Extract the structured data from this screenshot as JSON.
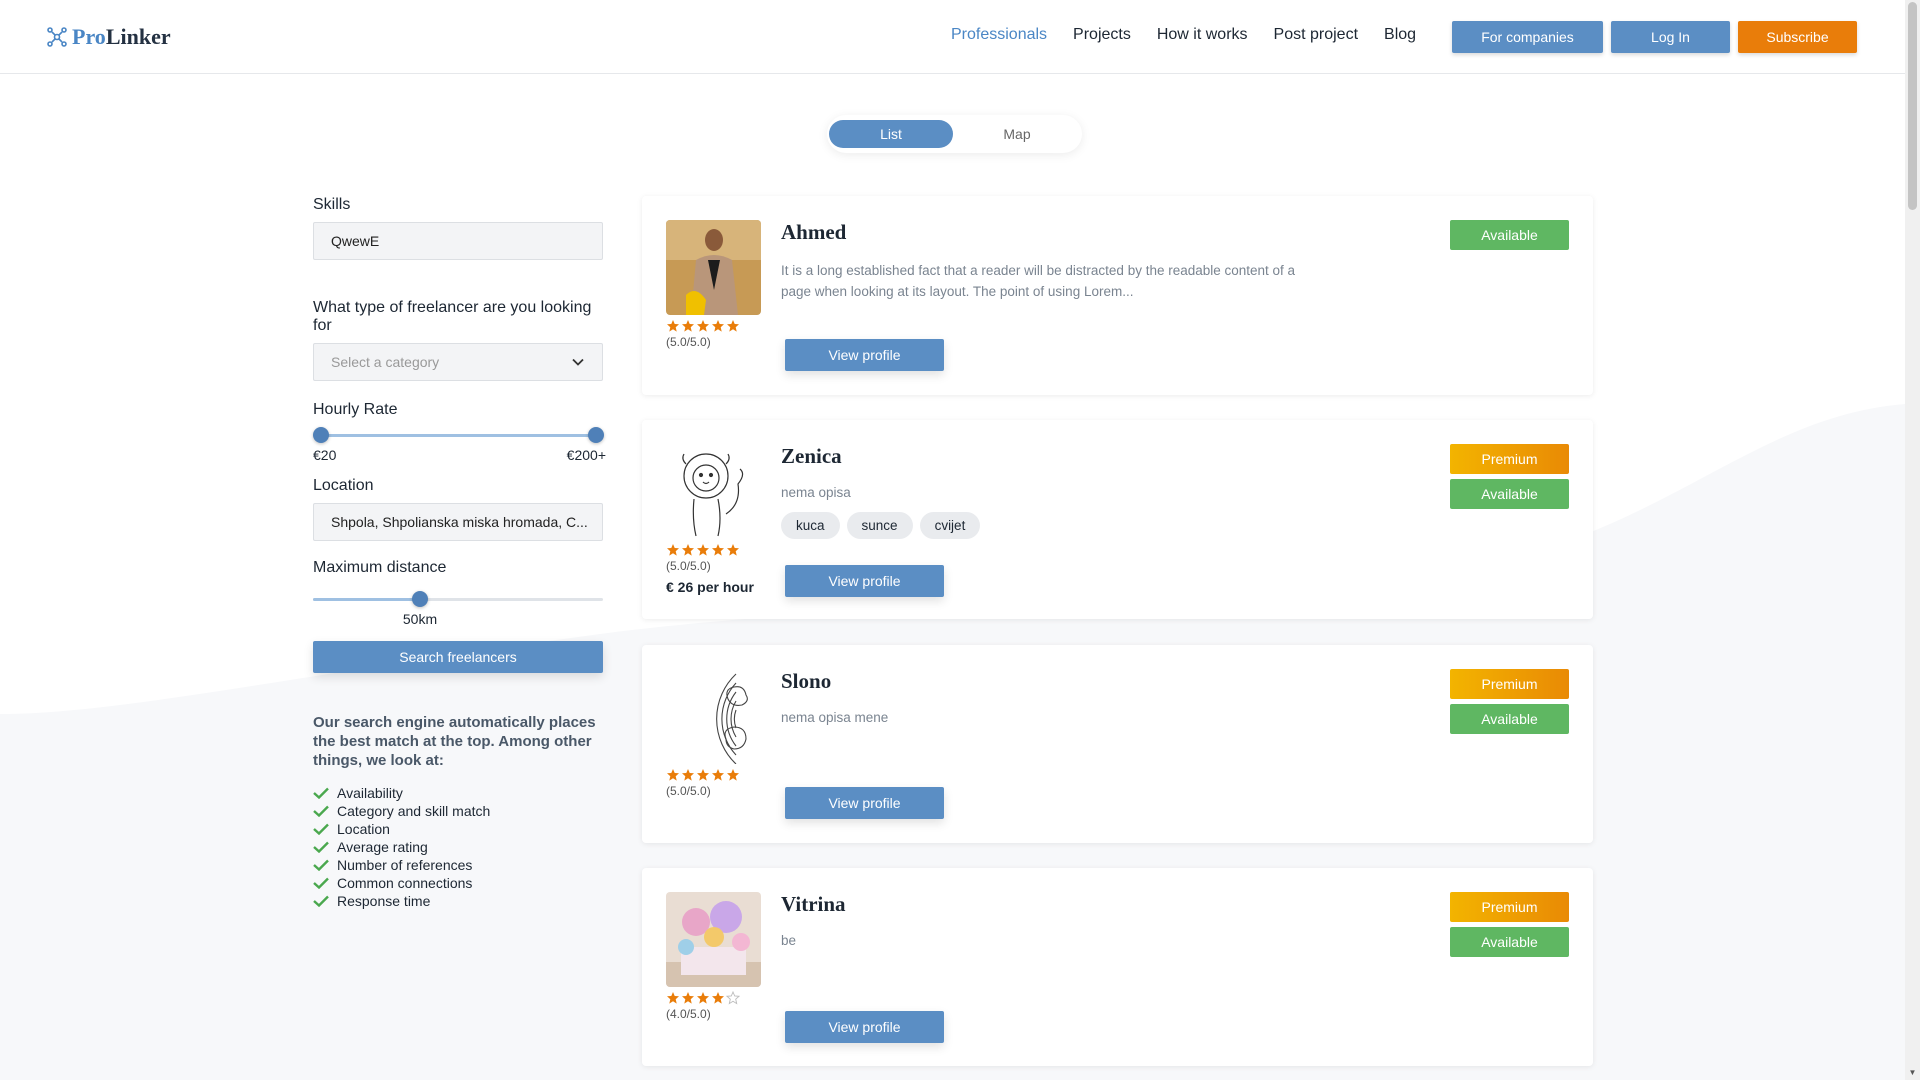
{
  "brand": {
    "pro": "Pro",
    "linker": "Linker"
  },
  "nav": [
    "Professionals",
    "Projects",
    "How it works",
    "Post project",
    "Blog"
  ],
  "header_buttons": {
    "companies": "For companies",
    "login": "Log In",
    "subscribe": "Subscribe"
  },
  "toggle": {
    "list": "List",
    "map": "Map"
  },
  "filters": {
    "skills_label": "Skills",
    "skills_value": "QwewE",
    "type_label": "What type of freelancer are you looking for",
    "type_placeholder": "Select a category",
    "rate_label": "Hourly Rate",
    "rate_min": "€20",
    "rate_max": "€200+",
    "location_label": "Location",
    "location_value": "Shpola, Shpolianska miska hromada, C...",
    "distance_label": "Maximum distance",
    "distance_value": "50km",
    "distance_fraction": 0.36,
    "search_button": "Search freelancers"
  },
  "info": {
    "text": "Our search engine automatically places the best match at the top. Among other things, we look at:",
    "items": [
      "Availability",
      "Category and skill match",
      "Location",
      "Average rating",
      "Number of references",
      "Common connections",
      "Response time"
    ]
  },
  "view_profile_label": "View profile",
  "freelancers": [
    {
      "name": "Ahmed",
      "description": "It is a long established fact that a reader will be distracted by the readable content of a page when looking at its layout. The point of using Lorem...",
      "rating": 5,
      "rating_text": "(5.0/5.0)",
      "badges": [
        "Available"
      ]
    },
    {
      "name": "Zenica",
      "description": "nema opisa",
      "tags": [
        "kuca",
        "sunce",
        "cvijet"
      ],
      "rating": 5,
      "rating_text": "(5.0/5.0)",
      "rate": "€ 26 per hour",
      "badges": [
        "Premium",
        "Available"
      ]
    },
    {
      "name": "Slono",
      "description": "nema opisa mene",
      "rating": 5,
      "rating_text": "(5.0/5.0)",
      "badges": [
        "Premium",
        "Available"
      ]
    },
    {
      "name": "Vitrina",
      "description": "be",
      "rating": 4,
      "rating_text": "(4.0/5.0)",
      "badges": [
        "Premium",
        "Available"
      ]
    }
  ],
  "colors": {
    "accent": "#5b8ec4",
    "orange": "#e97d0a",
    "available": "#5fb762",
    "star": "#e97d0a"
  }
}
